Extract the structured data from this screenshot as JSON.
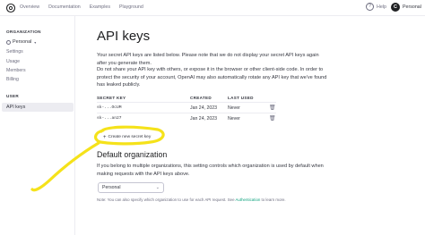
{
  "topbar": {
    "nav": [
      "Overview",
      "Documentation",
      "Examples",
      "Playground"
    ],
    "help": "Help",
    "user_initial": "C",
    "user_name": "Personal"
  },
  "sidebar": {
    "org_heading": "ORGANIZATION",
    "org_name": "Personal",
    "org_items": [
      "Settings",
      "Usage",
      "Members",
      "Billing"
    ],
    "user_heading": "USER",
    "user_items": [
      "API keys"
    ]
  },
  "main": {
    "title": "API keys",
    "para1": "Your secret API keys are listed below. Please note that we do not display your secret API keys again after you generate them.",
    "para2": "Do not share your API key with others, or expose it in the browser or other client-side code. In order to protect the security of your account, OpenAI may also automatically rotate any API key that we've found has leaked publicly.",
    "table": {
      "headers": [
        "SECRET KEY",
        "CREATED",
        "LAST USED"
      ],
      "rows": [
        {
          "key": "sk-...OcUM",
          "created": "Jan 24, 2023",
          "last_used": "Never"
        },
        {
          "key": "sk-...an27",
          "created": "Jan 24, 2023",
          "last_used": "Never"
        }
      ]
    },
    "create_button": "Create new secret key",
    "default_org_title": "Default organization",
    "para3": "If you belong to multiple organizations, this setting controls which organization is used by default when making requests with the API keys above.",
    "select_value": "Personal",
    "note_prefix": "Note: You can also specify which organization to use for each API request. See ",
    "note_link": "Authentication",
    "note_suffix": " to learn more."
  },
  "colors": {
    "accent_link": "#10a37f",
    "annotation": "#f5e21a",
    "active_bg": "#ececf1"
  }
}
